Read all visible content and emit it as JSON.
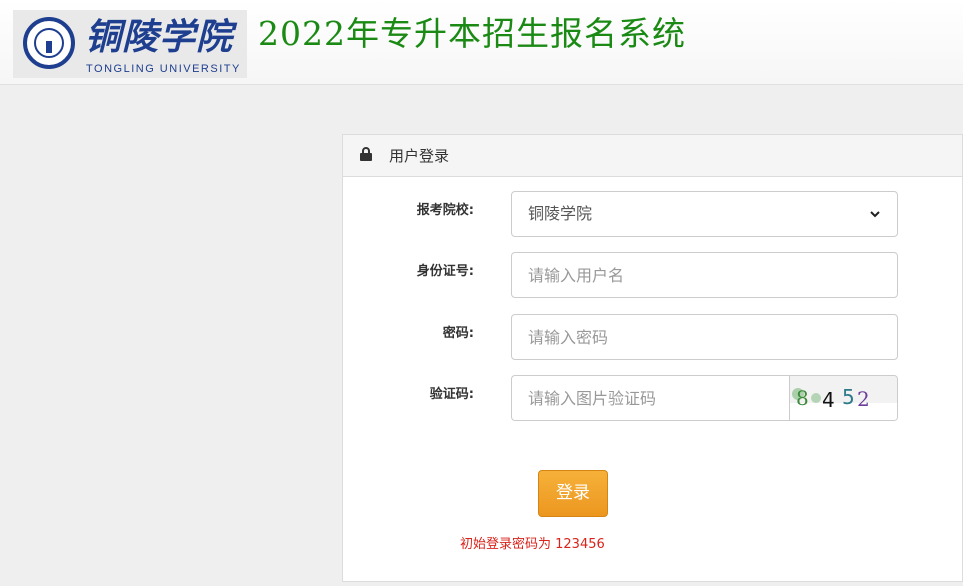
{
  "header": {
    "logo_name": "铜陵学院",
    "logo_en": "TONGLING UNIVERSITY",
    "title": "2022年专升本招生报名系统"
  },
  "panel": {
    "title": "用户登录",
    "icon": "lock-icon"
  },
  "form": {
    "school": {
      "label": "报考院校:",
      "value": "铜陵学院",
      "options": [
        "铜陵学院"
      ]
    },
    "id_number": {
      "label": "身份证号:",
      "placeholder": "请输入用户名"
    },
    "password": {
      "label": "密码:",
      "placeholder": "请输入密码"
    },
    "captcha": {
      "label": "验证码:",
      "placeholder": "请输入图片验证码",
      "image_text": "8452"
    },
    "login_label": "登录",
    "hint": "初始登录密码为 123456"
  },
  "colors": {
    "title_green": "#1a8a14",
    "brand_blue": "#1e3f8f",
    "button_orange": "#ec971f",
    "hint_red": "#d9231b"
  }
}
